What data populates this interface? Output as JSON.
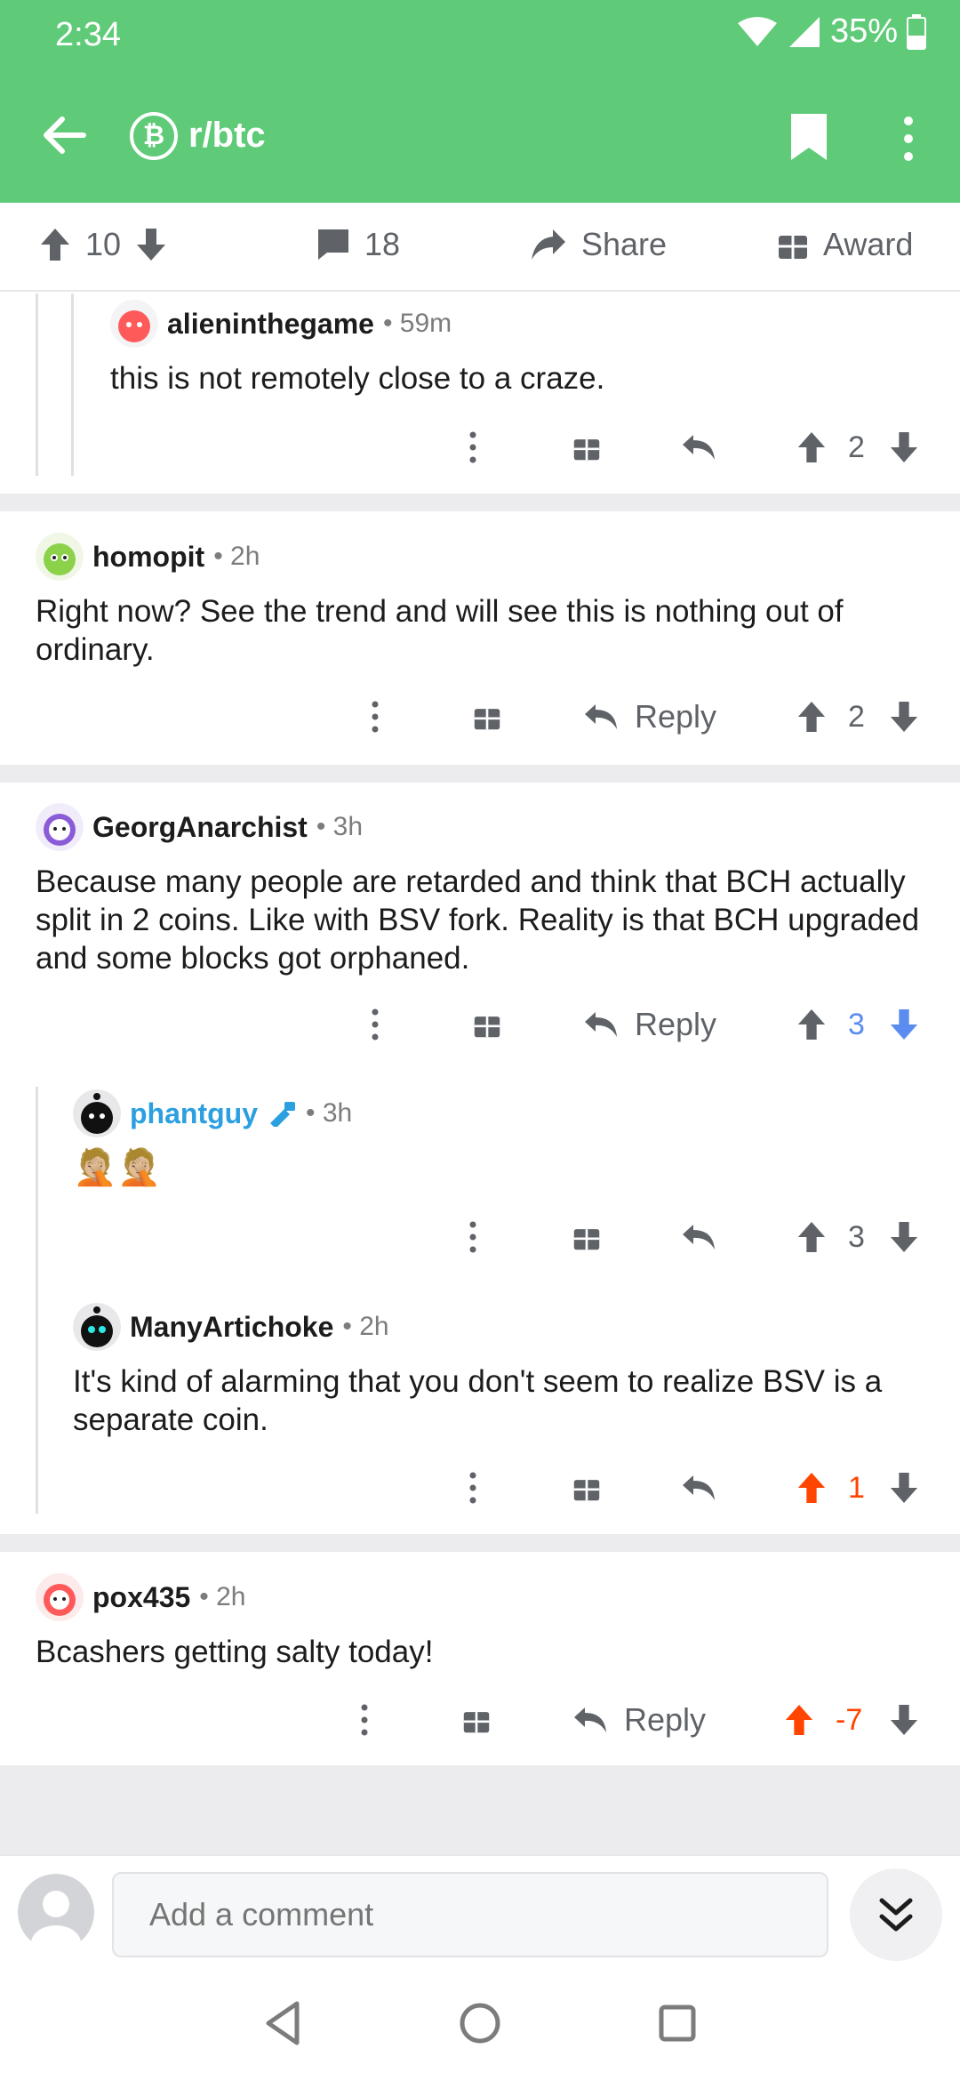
{
  "status_bar": {
    "time": "2:34",
    "battery": "35%",
    "icons": [
      "wifi-icon",
      "signal-icon",
      "battery-icon"
    ]
  },
  "app_bar": {
    "subreddit": "r/btc",
    "subreddit_icon": "bitcoin-icon",
    "icons": [
      "back-arrow-icon",
      "bookmark-icon",
      "more-vertical-icon"
    ]
  },
  "post_actions": {
    "score": "10",
    "comments": "18",
    "share": "Share",
    "award": "Award"
  },
  "comments": [
    {
      "author": "alieninthegame",
      "time": "59m",
      "body": "this is not remotely close to a craze.",
      "score": "2"
    },
    {
      "author": "homopit",
      "time": "2h",
      "body": "Right now? See the trend and will see this is nothing out of ordinary.",
      "reply": "Reply",
      "score": "2"
    },
    {
      "author": "GeorgAnarchist",
      "time": "3h",
      "body": "Because many people are retarded and think that BCH actually split in 2 coins. Like with BSV fork. Reality is that BCH upgraded and some blocks got orphaned.",
      "reply": "Reply",
      "score": "3",
      "vote": "downvoted"
    },
    {
      "author": "phantguy",
      "time": "3h",
      "body": "🤦🏼🤦🏼",
      "score": "3",
      "moderator": true
    },
    {
      "author": "ManyArtichoke",
      "time": "2h",
      "body": "It's kind of alarming that you don't seem to realize BSV is a separate coin.",
      "score": "1",
      "vote": "upvoted"
    },
    {
      "author": "pox435",
      "time": "2h",
      "body": "Bcashers getting salty today!",
      "reply": "Reply",
      "score": "-7",
      "vote": "upvoted"
    }
  ],
  "composer": {
    "placeholder": "Add a comment"
  },
  "colors": {
    "header_green": "#5fcb78",
    "upvote_orange": "#ff4500",
    "downvote_blue": "#5b8cf0",
    "mod_blue": "#2b9fe0"
  }
}
